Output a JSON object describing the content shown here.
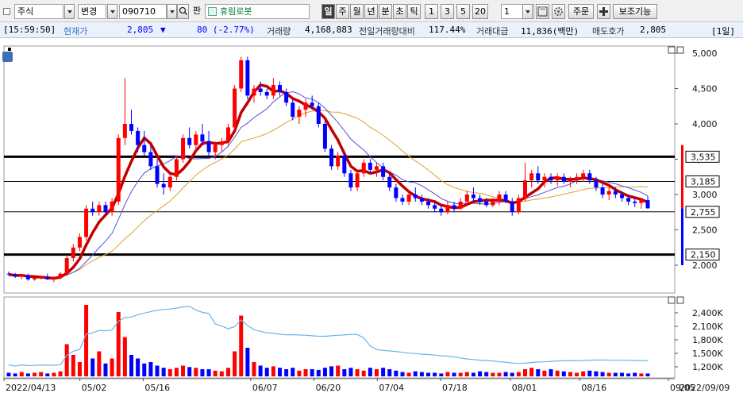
{
  "toolbar": {
    "market_select": "주식",
    "change_btn": "변경",
    "code_input": "090710",
    "search_icon": "search-icon",
    "order_label": "판",
    "stock_name": "휴림로봇",
    "periods": [
      "일",
      "주",
      "월",
      "년",
      "분",
      "초",
      "틱"
    ],
    "active_period": "일",
    "intervals": [
      "1",
      "3",
      "5",
      "20"
    ],
    "interval_value": "1",
    "order_btn": "주문",
    "aux_btn": "보조기능"
  },
  "info": {
    "time": "[15:59:50]",
    "price_label": "현재가",
    "price": "2,805",
    "arrow": "▼",
    "change": "80 (-2.77%)",
    "volume_label": "거래량",
    "volume": "4,168,883",
    "prev_ratio_label": "전일거래량대비",
    "prev_ratio": "117.44%",
    "amount_label": "거래대금",
    "amount": "11,836(백만)",
    "ask_label": "매도호가",
    "ask": "2,805",
    "period_tag": "[1일]"
  },
  "chart_data": {
    "type": "candlestick",
    "date_range": [
      "2022/04/13",
      "2022/09/09"
    ],
    "x_tick_labels": [
      "2022/04/13",
      "05/02",
      "05/16",
      "06/07",
      "06/20",
      "07/04",
      "07/18",
      "08/01",
      "08/16",
      "09/05"
    ],
    "x_tick_index": [
      0,
      12,
      22,
      39,
      49,
      59,
      69,
      80,
      91,
      105
    ],
    "price_axis": {
      "min": 2000,
      "max": 5000,
      "ticks": [
        "5,000",
        "4,500",
        "4,000",
        "3,500",
        "3,000",
        "2,500",
        "2,000"
      ]
    },
    "volume_axis": {
      "ticks": [
        "2,400K",
        "2,100K",
        "1,800K",
        "1,500K",
        "1,200K"
      ]
    },
    "horizontal_lines": [
      {
        "label": "3,535",
        "value": 3535,
        "weight": "thick"
      },
      {
        "label": "3,185",
        "value": 3185,
        "weight": "thin"
      },
      {
        "label": "2,755",
        "value": 2755,
        "weight": "thin"
      },
      {
        "label": "2,150",
        "value": 2150,
        "weight": "thick"
      }
    ],
    "series_colors": {
      "up": "#ff0000",
      "down": "#0000ff",
      "ma_main": "#c00000",
      "ma_short": "#5050e0",
      "ma_long": "#e0a030",
      "vol_line": "#6ab4e8"
    },
    "candles": [
      [
        1,
        1.88,
        1.91,
        1.85,
        1.87
      ],
      [
        2,
        1.87,
        1.89,
        1.82,
        1.84
      ],
      [
        3,
        1.84,
        1.87,
        1.8,
        1.86
      ],
      [
        4,
        1.86,
        1.88,
        1.78,
        1.8
      ],
      [
        5,
        1.8,
        1.83,
        1.78,
        1.82
      ],
      [
        6,
        1.82,
        1.85,
        1.8,
        1.83
      ],
      [
        7,
        1.83,
        1.88,
        1.79,
        1.8
      ],
      [
        8,
        1.8,
        1.84,
        1.76,
        1.82
      ],
      [
        9,
        1.82,
        1.9,
        1.8,
        1.88
      ],
      [
        10,
        1.88,
        2.15,
        1.85,
        2.1
      ],
      [
        11,
        2.1,
        2.3,
        2.05,
        2.25
      ],
      [
        12,
        2.25,
        2.45,
        2.2,
        2.4
      ],
      [
        13,
        2.4,
        2.85,
        2.35,
        2.8
      ],
      [
        14,
        2.8,
        2.9,
        2.7,
        2.75
      ],
      [
        15,
        2.75,
        2.9,
        2.7,
        2.85
      ],
      [
        16,
        2.85,
        2.9,
        2.7,
        2.75
      ],
      [
        17,
        2.75,
        2.95,
        2.7,
        2.9
      ],
      [
        18,
        2.9,
        3.85,
        2.85,
        3.8
      ],
      [
        19,
        3.8,
        4.65,
        3.7,
        4.0
      ],
      [
        20,
        4.0,
        4.2,
        3.85,
        3.9
      ],
      [
        21,
        3.9,
        3.95,
        3.6,
        3.7
      ],
      [
        22,
        3.7,
        3.9,
        3.55,
        3.6
      ],
      [
        23,
        3.6,
        3.7,
        3.35,
        3.4
      ],
      [
        24,
        3.4,
        3.5,
        3.1,
        3.15
      ],
      [
        25,
        3.15,
        3.3,
        3.0,
        3.1
      ],
      [
        26,
        3.1,
        3.3,
        3.05,
        3.25
      ],
      [
        27,
        3.25,
        3.55,
        3.2,
        3.5
      ],
      [
        28,
        3.5,
        3.85,
        3.45,
        3.8
      ],
      [
        29,
        3.8,
        3.95,
        3.65,
        3.7
      ],
      [
        30,
        3.7,
        3.9,
        3.6,
        3.85
      ],
      [
        31,
        3.85,
        4.0,
        3.7,
        3.75
      ],
      [
        32,
        3.75,
        3.9,
        3.55,
        3.6
      ],
      [
        33,
        3.6,
        3.75,
        3.5,
        3.7
      ],
      [
        34,
        3.7,
        3.8,
        3.6,
        3.75
      ],
      [
        35,
        3.75,
        4.0,
        3.7,
        3.95
      ],
      [
        36,
        3.95,
        4.55,
        3.9,
        4.5
      ],
      [
        37,
        4.5,
        4.95,
        4.45,
        4.9
      ],
      [
        38,
        4.9,
        4.95,
        4.35,
        4.4
      ],
      [
        39,
        4.4,
        4.55,
        4.3,
        4.5
      ],
      [
        40,
        4.5,
        4.6,
        4.4,
        4.45
      ],
      [
        41,
        4.45,
        4.5,
        4.35,
        4.4
      ],
      [
        42,
        4.4,
        4.65,
        4.35,
        4.55
      ],
      [
        43,
        4.55,
        4.6,
        4.4,
        4.45
      ],
      [
        44,
        4.45,
        4.5,
        4.25,
        4.3
      ],
      [
        45,
        4.3,
        4.35,
        4.05,
        4.1
      ],
      [
        46,
        4.1,
        4.25,
        4.0,
        4.2
      ],
      [
        47,
        4.2,
        4.35,
        4.1,
        4.3
      ],
      [
        48,
        4.3,
        4.4,
        4.2,
        4.25
      ],
      [
        49,
        4.25,
        4.3,
        3.95,
        4.0
      ],
      [
        50,
        4.0,
        4.05,
        3.6,
        3.65
      ],
      [
        51,
        3.65,
        3.7,
        3.35,
        3.4
      ],
      [
        52,
        3.4,
        3.6,
        3.35,
        3.55
      ],
      [
        53,
        3.55,
        3.6,
        3.25,
        3.3
      ],
      [
        54,
        3.3,
        3.35,
        3.05,
        3.1
      ],
      [
        55,
        3.1,
        3.35,
        3.05,
        3.3
      ],
      [
        56,
        3.3,
        3.5,
        3.25,
        3.45
      ],
      [
        57,
        3.45,
        3.5,
        3.3,
        3.35
      ],
      [
        58,
        3.35,
        3.45,
        3.25,
        3.4
      ],
      [
        59,
        3.4,
        3.45,
        3.2,
        3.25
      ],
      [
        60,
        3.25,
        3.3,
        3.05,
        3.1
      ],
      [
        61,
        3.1,
        3.15,
        2.9,
        2.95
      ],
      [
        62,
        2.95,
        3.0,
        2.85,
        2.9
      ],
      [
        63,
        2.9,
        3.05,
        2.85,
        3.0
      ],
      [
        64,
        3.0,
        3.1,
        2.9,
        2.95
      ],
      [
        65,
        2.95,
        3.0,
        2.85,
        2.9
      ],
      [
        66,
        2.9,
        2.95,
        2.8,
        2.85
      ],
      [
        67,
        2.85,
        2.9,
        2.75,
        2.8
      ],
      [
        68,
        2.8,
        2.85,
        2.7,
        2.75
      ],
      [
        69,
        2.75,
        2.9,
        2.72,
        2.85
      ],
      [
        70,
        2.85,
        2.9,
        2.75,
        2.8
      ],
      [
        71,
        2.8,
        2.95,
        2.78,
        2.9
      ],
      [
        72,
        2.9,
        3.05,
        2.85,
        3.0
      ],
      [
        73,
        3.0,
        3.1,
        2.9,
        2.95
      ],
      [
        74,
        2.95,
        3.0,
        2.85,
        2.9
      ],
      [
        75,
        2.9,
        2.95,
        2.82,
        2.85
      ],
      [
        76,
        2.85,
        2.95,
        2.82,
        2.9
      ],
      [
        77,
        2.9,
        3.05,
        2.85,
        3.0
      ],
      [
        78,
        3.0,
        3.05,
        2.88,
        2.9
      ],
      [
        79,
        2.9,
        2.95,
        2.7,
        2.75
      ],
      [
        80,
        2.75,
        3.0,
        2.72,
        2.95
      ],
      [
        81,
        2.95,
        3.45,
        2.9,
        3.2
      ],
      [
        82,
        3.2,
        3.35,
        3.1,
        3.3
      ],
      [
        83,
        3.3,
        3.4,
        3.15,
        3.2
      ],
      [
        84,
        3.2,
        3.3,
        3.1,
        3.25
      ],
      [
        85,
        3.25,
        3.3,
        3.15,
        3.2
      ],
      [
        86,
        3.2,
        3.3,
        3.12,
        3.25
      ],
      [
        87,
        3.25,
        3.3,
        3.15,
        3.18
      ],
      [
        88,
        3.18,
        3.25,
        3.1,
        3.2
      ],
      [
        89,
        3.2,
        3.3,
        3.15,
        3.25
      ],
      [
        90,
        3.25,
        3.35,
        3.18,
        3.3
      ],
      [
        91,
        3.3,
        3.35,
        3.15,
        3.2
      ],
      [
        92,
        3.2,
        3.25,
        3.05,
        3.1
      ],
      [
        93,
        3.1,
        3.15,
        2.95,
        3.0
      ],
      [
        94,
        3.0,
        3.1,
        2.92,
        3.05
      ],
      [
        95,
        3.05,
        3.1,
        2.95,
        3.0
      ],
      [
        96,
        3.0,
        3.05,
        2.9,
        2.95
      ],
      [
        97,
        2.95,
        3.0,
        2.85,
        2.9
      ],
      [
        98,
        2.9,
        2.95,
        2.82,
        2.88
      ],
      [
        99,
        2.88,
        2.95,
        2.8,
        2.92
      ],
      [
        100,
        2.92,
        2.98,
        2.8,
        2.805
      ]
    ],
    "volume": [
      0.05,
      0.04,
      0.06,
      0.04,
      0.05,
      0.06,
      0.04,
      0.05,
      0.07,
      0.45,
      0.3,
      0.2,
      1.0,
      0.25,
      0.35,
      0.18,
      0.25,
      0.9,
      0.55,
      0.3,
      0.25,
      0.18,
      0.2,
      0.15,
      0.12,
      0.1,
      0.12,
      0.15,
      0.13,
      0.12,
      0.1,
      0.1,
      0.08,
      0.07,
      0.12,
      0.35,
      0.85,
      0.4,
      0.2,
      0.15,
      0.12,
      0.14,
      0.12,
      0.1,
      0.12,
      0.08,
      0.1,
      0.1,
      0.09,
      0.12,
      0.14,
      0.15,
      0.1,
      0.12,
      0.1,
      0.08,
      0.12,
      0.1,
      0.12,
      0.1,
      0.08,
      0.06,
      0.05,
      0.07,
      0.06,
      0.05,
      0.05,
      0.04,
      0.06,
      0.05,
      0.05,
      0.06,
      0.05,
      0.07,
      0.06,
      0.05,
      0.05,
      0.06,
      0.05,
      0.06,
      0.1,
      0.12,
      0.1,
      0.08,
      0.1,
      0.08,
      0.07,
      0.06,
      0.05,
      0.07,
      0.08,
      0.07,
      0.06,
      0.05,
      0.05,
      0.05,
      0.04,
      0.05,
      0.04,
      0.04,
      0.04
    ],
    "date_bar_extra": "2022/09/09"
  }
}
